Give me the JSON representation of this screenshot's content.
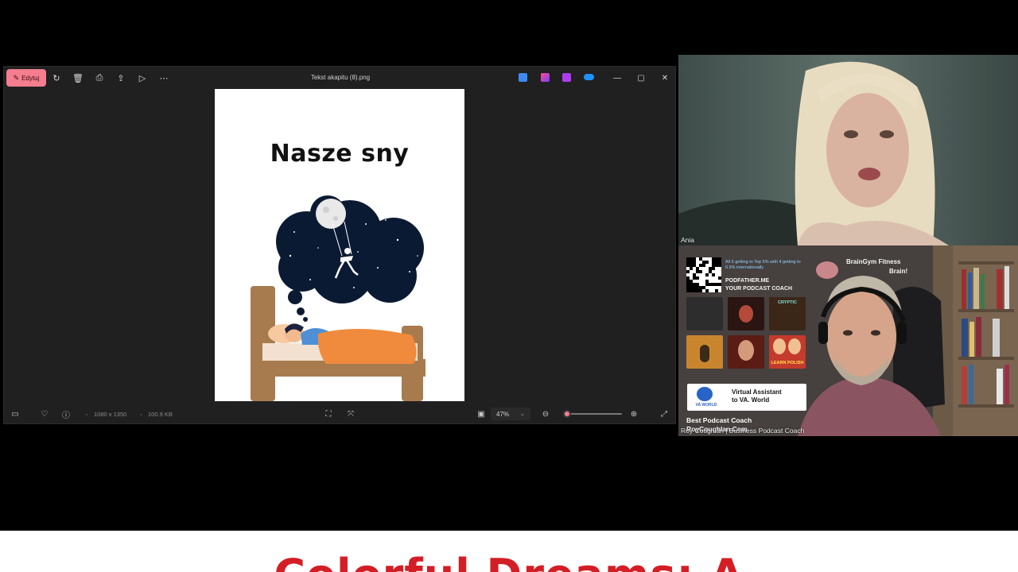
{
  "viewer": {
    "edit_label": "Edytuj",
    "file_title": "Tekst akapitu (8).png",
    "image_heading": "Nasze sny",
    "dimensions": "1080 x 1350",
    "file_size": "100.9 KB",
    "zoom_label": "47%",
    "zoom_fraction": 0.07
  },
  "participants": {
    "first_name": "Ania",
    "second_name": "Roy Coughlan | Business Podcast Coach"
  },
  "banner": {
    "top_small": "All 6 getting to Top 5% with 4 getting to 0.5% internationally",
    "podfather": "PODFATHER.ME",
    "your_coach": "YOUR PODCAST COACH",
    "braingym_line1": "BrainGym Fitness",
    "braingym_line2": "Brain!",
    "thumb_cryptic": "CRYPTIC",
    "thumb_learn": "LEARN POLISH",
    "va_world": "VA WORLD",
    "va_line1": "Virtual Assistant",
    "va_line2": "to VA. World",
    "coach_line1": "Best Podcast Coach",
    "coach_line2": "RoyCoughlan.Com"
  },
  "caption": {
    "text": "Colorful Dreams: A"
  },
  "colors": {
    "accent": "#f47d8e",
    "caption_red": "#d41e26",
    "window_bg": "#202020"
  }
}
